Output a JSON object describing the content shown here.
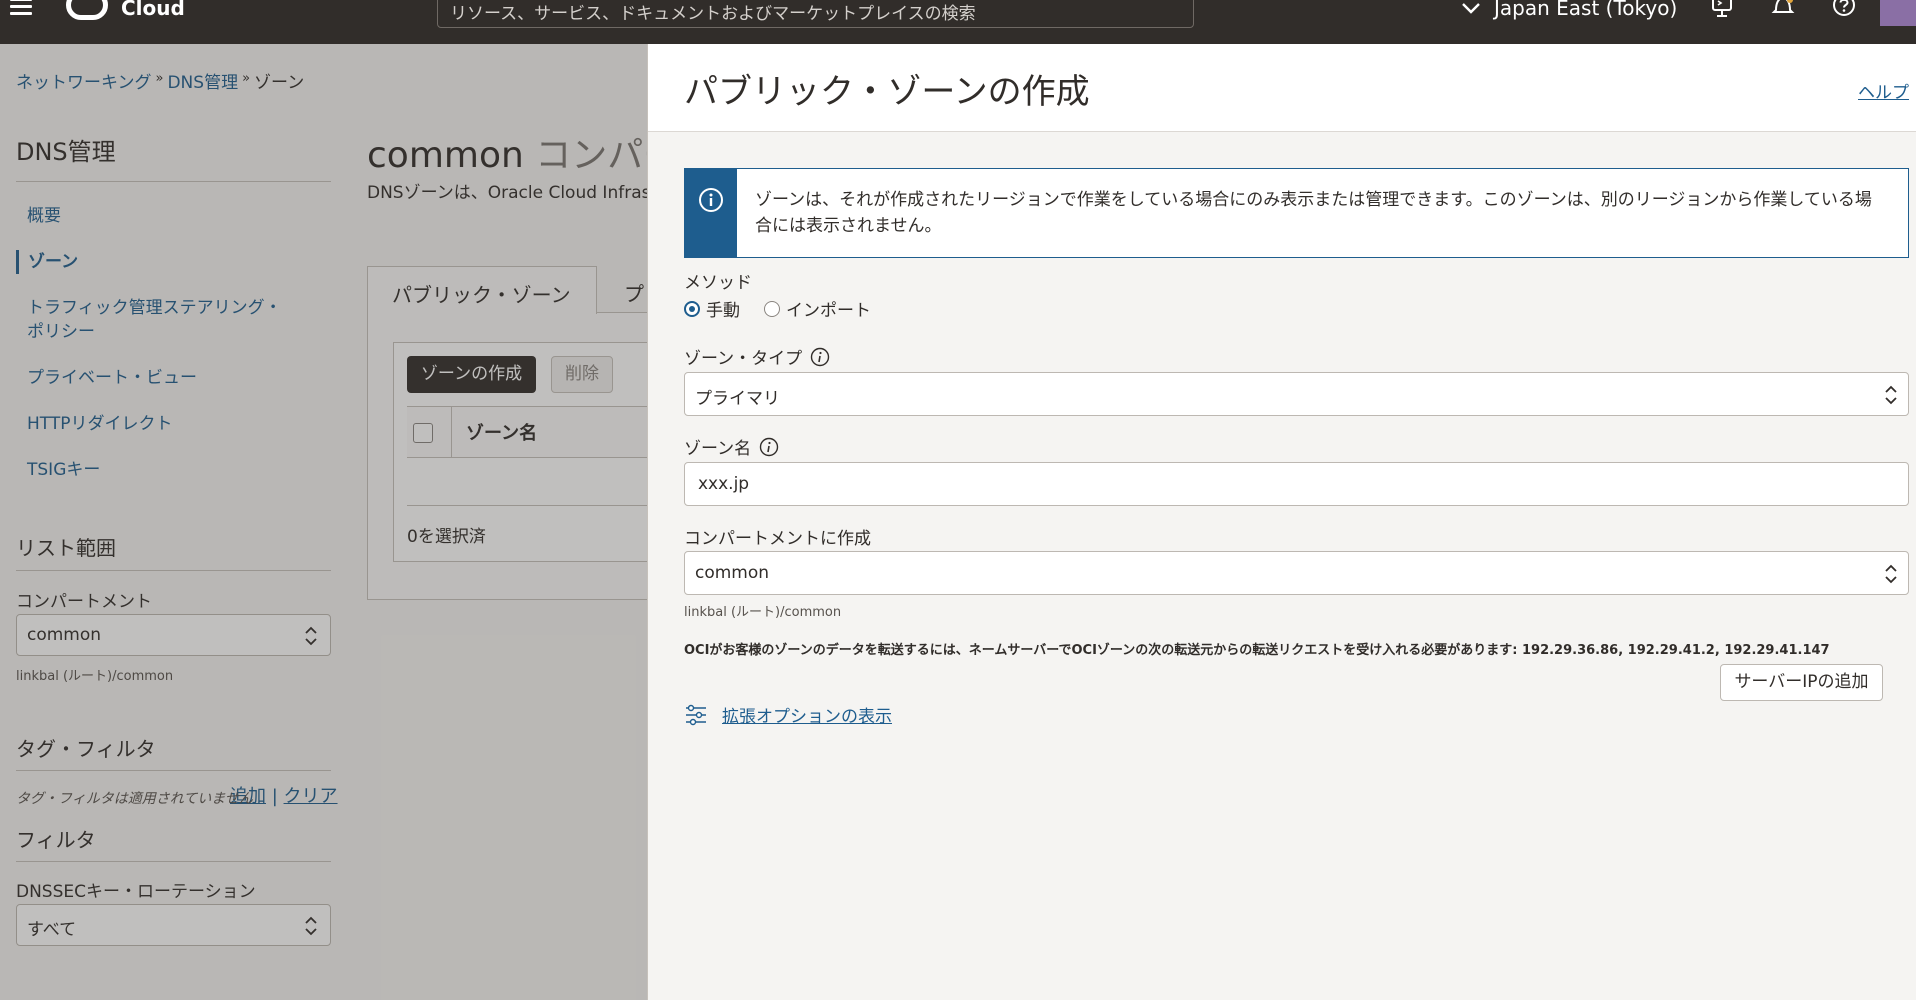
{
  "header": {
    "brand": "Cloud",
    "search_placeholder": "リソース、サービス、ドキュメントおよびマーケットプレイスの検索",
    "region": "Japan East (Tokyo)"
  },
  "breadcrumb": {
    "items": [
      "ネットワーキング",
      "DNS管理",
      "ゾーン"
    ],
    "separator": "»"
  },
  "sidebar": {
    "title": "DNS管理",
    "nav": [
      "概要",
      "ゾーン",
      "トラフィック管理ステアリング・ポリシー",
      "プライベート・ビュー",
      "HTTPリダイレクト",
      "TSIGキー"
    ],
    "list_scope_title": "リスト範囲",
    "compartment_label": "コンパートメント",
    "compartment_value": "common",
    "compartment_path": "linkbal (ルート)/common",
    "tag_filter_title": "タグ・フィルタ",
    "tag_add": "追加",
    "tag_divider": "|",
    "tag_clear": "クリア",
    "tag_none": "タグ・フィルタは適用されていません",
    "filter_title": "フィルタ",
    "dnssec_label": "DNSSECキー・ローテーション",
    "dnssec_value": "すべて"
  },
  "main": {
    "title": "common",
    "title_suffix": "コンパー",
    "description": "DNSゾーンは、Oracle Cloud Infrast",
    "tabs": [
      "パブリック・ゾーン",
      "プ"
    ],
    "create_button": "ゾーンの作成",
    "delete_button": "削除",
    "column_zone_name": "ゾーン名",
    "selected_count": "0を選択済"
  },
  "drawer": {
    "title": "パブリック・ゾーンの作成",
    "help": "ヘルプ",
    "info_message": "ゾーンは、それが作成されたリージョンで作業をしている場合にのみ表示または管理できます。このゾーンは、別のリージョンから作業している場合には表示されません。",
    "method_label": "メソッド",
    "method_manual": "手動",
    "method_import": "インポート",
    "zone_type_label": "ゾーン・タイプ",
    "zone_type_value": "プライマリ",
    "zone_name_label": "ゾーン名",
    "zone_name_value": "xxx.jp",
    "compartment_label": "コンパートメントに作成",
    "compartment_value": "common",
    "compartment_path": "linkbal (ルート)/common",
    "transfer_note": "OCIがお客様のゾーンのデータを転送するには、ネームサーバーでOCIゾーンの次の転送元からの転送リクエストを受け入れる必要があります: 192.29.36.86, 192.29.41.2, 192.29.41.147",
    "add_server_ip": "サーバーIPの追加",
    "advanced_options": "拡張オプションの表示"
  },
  "colors": {
    "topbar": "#312d2a",
    "link": "#1e5d8e",
    "info_strip": "#1e5d8e"
  }
}
